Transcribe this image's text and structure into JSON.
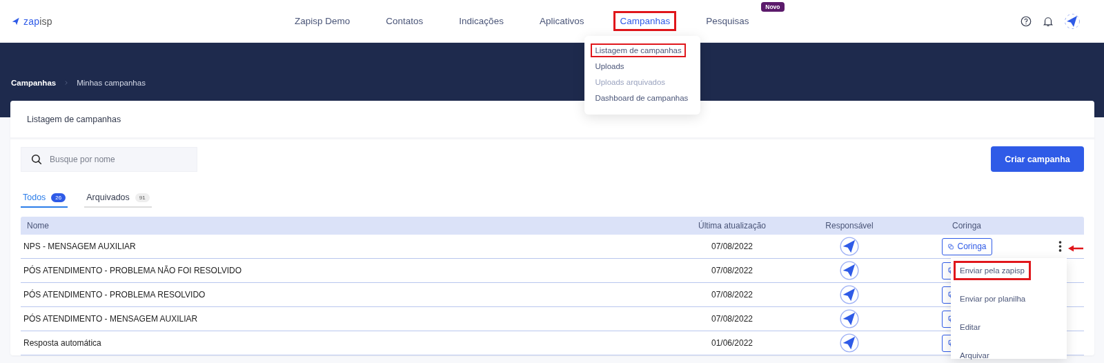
{
  "brand": {
    "part_1": "zap",
    "part_2": "isp"
  },
  "nav": [
    {
      "label": "Zapisp Demo",
      "selected": false,
      "highlighted": false
    },
    {
      "label": "Contatos",
      "selected": false,
      "highlighted": false
    },
    {
      "label": "Indicações",
      "selected": false,
      "highlighted": false
    },
    {
      "label": "Aplicativos",
      "selected": false,
      "highlighted": false
    },
    {
      "label": "Campanhas",
      "selected": true,
      "highlighted": true
    },
    {
      "label": "Pesquisas",
      "selected": false,
      "highlighted": false,
      "badge": "Novo"
    }
  ],
  "nav_menu": [
    {
      "label": "Listagem de campanhas",
      "disabled": false,
      "highlighted": true
    },
    {
      "label": "Uploads",
      "disabled": false,
      "highlighted": false
    },
    {
      "label": "Uploads arquivados",
      "disabled": true,
      "highlighted": false
    },
    {
      "label": "Dashboard de campanhas",
      "disabled": false,
      "highlighted": false
    }
  ],
  "breadcrumb": [
    "Campanhas",
    "Minhas campanhas"
  ],
  "card": {
    "title": "Listagem de campanhas",
    "search": {
      "placeholder": "Busque por nome"
    },
    "create_button": "Criar campanha"
  },
  "tabs": [
    {
      "label": "Todos",
      "count": "26",
      "selected": true
    },
    {
      "label": "Arquivados",
      "count": "91",
      "selected": false
    }
  ],
  "table": {
    "columns": [
      "Nome",
      "Última atualização",
      "Responsável",
      "Coringa"
    ],
    "rows": [
      {
        "name": "NPS - MENSAGEM AUXILIAR",
        "updated": "07/08/2022",
        "coringa": "Coringa",
        "kebab": true
      },
      {
        "name": "PÓS ATENDIMENTO - PROBLEMA NÃO FOI RESOLVIDO",
        "updated": "07/08/2022"
      },
      {
        "name": "PÓS ATENDIMENTO - PROBLEMA RESOLVIDO",
        "updated": "07/08/2022"
      },
      {
        "name": "PÓS ATENDIMENTO - MENSAGEM AUXILIAR",
        "updated": "07/08/2022"
      },
      {
        "name": "Resposta automática",
        "updated": "01/06/2022"
      }
    ]
  },
  "row_menu": {
    "pointer_arrow": true,
    "items": [
      {
        "label": "Enviar pela zapisp",
        "highlighted": true
      },
      {
        "label": "Enviar por planilha",
        "highlighted": false
      },
      {
        "label": "Editar",
        "highlighted": false
      },
      {
        "label": "Arquivar",
        "highlighted": false
      }
    ]
  }
}
